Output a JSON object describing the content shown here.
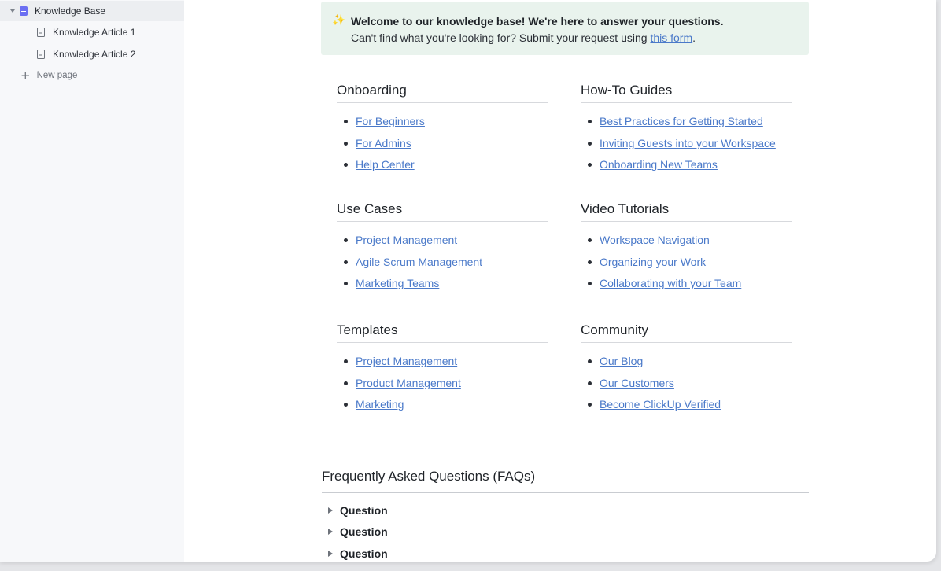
{
  "sidebar": {
    "root": {
      "label": "Knowledge Base"
    },
    "items": [
      {
        "label": "Knowledge Article 1"
      },
      {
        "label": "Knowledge Article 2"
      }
    ],
    "new_page_label": "New page"
  },
  "callout": {
    "icon": "sparkles-icon",
    "title": "Welcome to our knowledge base! We're here to answer your questions.",
    "subtitle_before": "Can't find what you're looking for? Submit your request using ",
    "link_text": "this form",
    "subtitle_after": "."
  },
  "sections": [
    {
      "title": "Onboarding",
      "links": [
        "For Beginners",
        "For Admins",
        "Help Center"
      ]
    },
    {
      "title": "How-To Guides",
      "links": [
        "Best Practices for Getting Started",
        "Inviting Guests into your Workspace",
        "Onboarding New Teams"
      ]
    },
    {
      "title": "Use Cases",
      "links": [
        "Project Management",
        "Agile Scrum Management",
        "Marketing Teams"
      ]
    },
    {
      "title": "Video Tutorials",
      "links": [
        "Workspace Navigation",
        "Organizing your Work",
        "Collaborating with your Team"
      ]
    },
    {
      "title": "Templates",
      "links": [
        "Project Management",
        "Product Management",
        "Marketing"
      ]
    },
    {
      "title": "Community",
      "links": [
        "Our Blog",
        "Our Customers",
        "Become ClickUp Verified"
      ]
    }
  ],
  "faq": {
    "title": "Frequently Asked Questions (FAQs)",
    "items": [
      "Question",
      "Question",
      "Question"
    ]
  },
  "colors": {
    "link": "#4a79c9",
    "callout_bg": "#e9f3ed",
    "accent": "#6b6ff2"
  }
}
